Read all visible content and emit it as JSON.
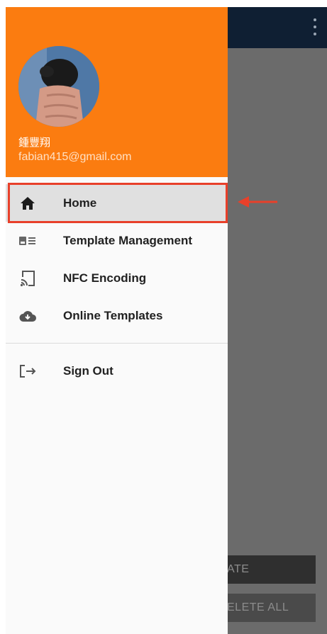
{
  "drawer": {
    "user_name": "鍾豐翔",
    "user_email": "fabian415@gmail.com",
    "items": [
      {
        "label": "Home",
        "icon": "home-icon"
      },
      {
        "label": "Template Management",
        "icon": "id-card-icon"
      },
      {
        "label": "NFC Encoding",
        "icon": "cast-icon"
      },
      {
        "label": "Online Templates",
        "icon": "cloud-download-icon"
      },
      {
        "label": "Sign Out",
        "icon": "logout-icon"
      }
    ],
    "selected": "Home"
  },
  "background": {
    "button1": "ATE",
    "button2": "ELETE ALL"
  },
  "colors": {
    "header": "#fb7c10",
    "appbar": "#0f1f33",
    "highlight": "#e8402a"
  }
}
